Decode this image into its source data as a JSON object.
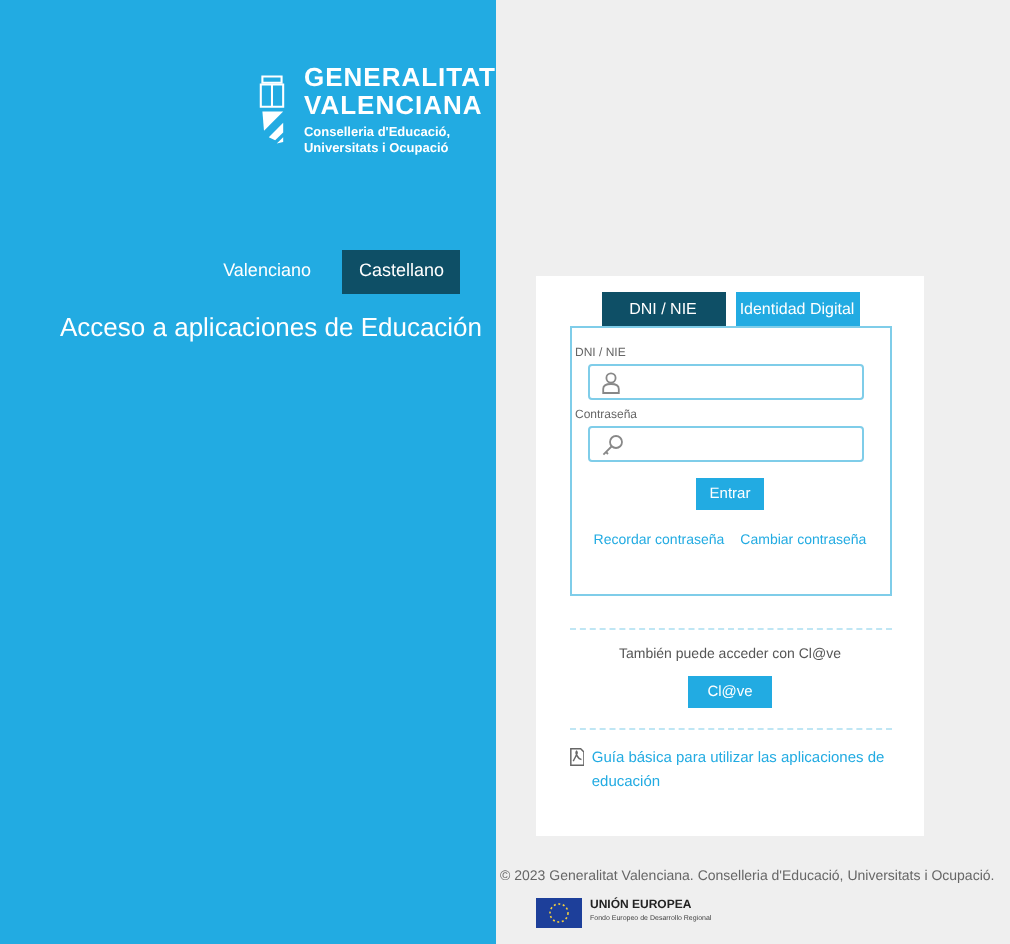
{
  "brand": {
    "line_1": "GENERALITAT",
    "line_2": "VALENCIANA",
    "department_1": "Conselleria d'Educació,",
    "department_2": "Universitats i Ocupació"
  },
  "languages": [
    {
      "label": "Valenciano",
      "selected": false
    },
    {
      "label": "Castellano",
      "selected": true
    }
  ],
  "headline": "Acceso a aplicaciones de Educación",
  "tabs": [
    {
      "label": "DNI / NIE",
      "selected": true
    },
    {
      "label": "Identidad Digital",
      "selected": false
    }
  ],
  "fields": [
    {
      "label": "DNI / NIE",
      "kind": "user"
    },
    {
      "label": "Contraseña",
      "kind": "key"
    }
  ],
  "submit": "Entrar",
  "links": [
    "Recordar contraseña",
    "Cambiar contraseña"
  ],
  "clave_text": "También puede acceder con Cl@ve",
  "clave_button": "Cl@ve",
  "guide_link": "Guía básica para utilizar las aplicaciones de educación",
  "footer": "© 2023 Generalitat Valenciana. Conselleria d'Educació, Universitats i Ocupació.",
  "eu": {
    "title": "UNIÓN EUROPEA",
    "subtitle": "Fondo Europeo de Desarrollo Regional"
  }
}
